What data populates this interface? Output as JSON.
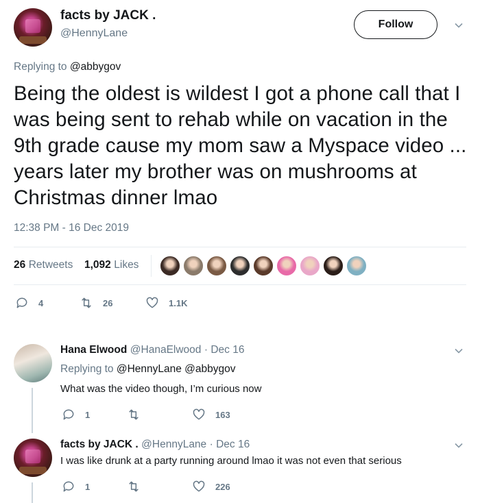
{
  "main_tweet": {
    "author_name": "facts by JACK .",
    "author_handle": "@HennyLane",
    "follow_label": "Follow",
    "replying_prefix": "Replying to",
    "replying_to": "@abbygov",
    "text": "Being the oldest is wildest I got a phone call that I was being sent to rehab while on vacation in the 9th grade cause my mom saw a Myspace video ... years later my brother was on mushrooms at Christmas dinner lmao",
    "timestamp": "12:38 PM - 16 Dec 2019",
    "retweets_count": "26",
    "retweets_label": "Retweets",
    "likes_count": "1,092",
    "likes_label": "Likes",
    "actions": {
      "replies": "4",
      "retweets": "26",
      "likes": "1.1K"
    },
    "liker_colors": [
      "#3b2a24",
      "#8a7a6a",
      "#7a5a44",
      "#2d2d2d",
      "#5a3a2a",
      "#e86aa8",
      "#e9a7c8",
      "#2a1d18",
      "#7fb0c2"
    ]
  },
  "replies": [
    {
      "author_name": "Hana Elwood",
      "author_handle": "@HanaElwood",
      "date": "· Dec 16",
      "replying_prefix": "Replying to",
      "replying_to": "@HennyLane @abbygov",
      "text": "What was the video though, I’m curious now",
      "replies": "1",
      "retweets": "",
      "likes": "163"
    },
    {
      "author_name": "facts by JACK .",
      "author_handle": "@HennyLane",
      "date": "· Dec 16",
      "text": "I was like drunk at a party running around lmao it was not even that serious",
      "replies": "1",
      "retweets": "",
      "likes": "226"
    }
  ]
}
